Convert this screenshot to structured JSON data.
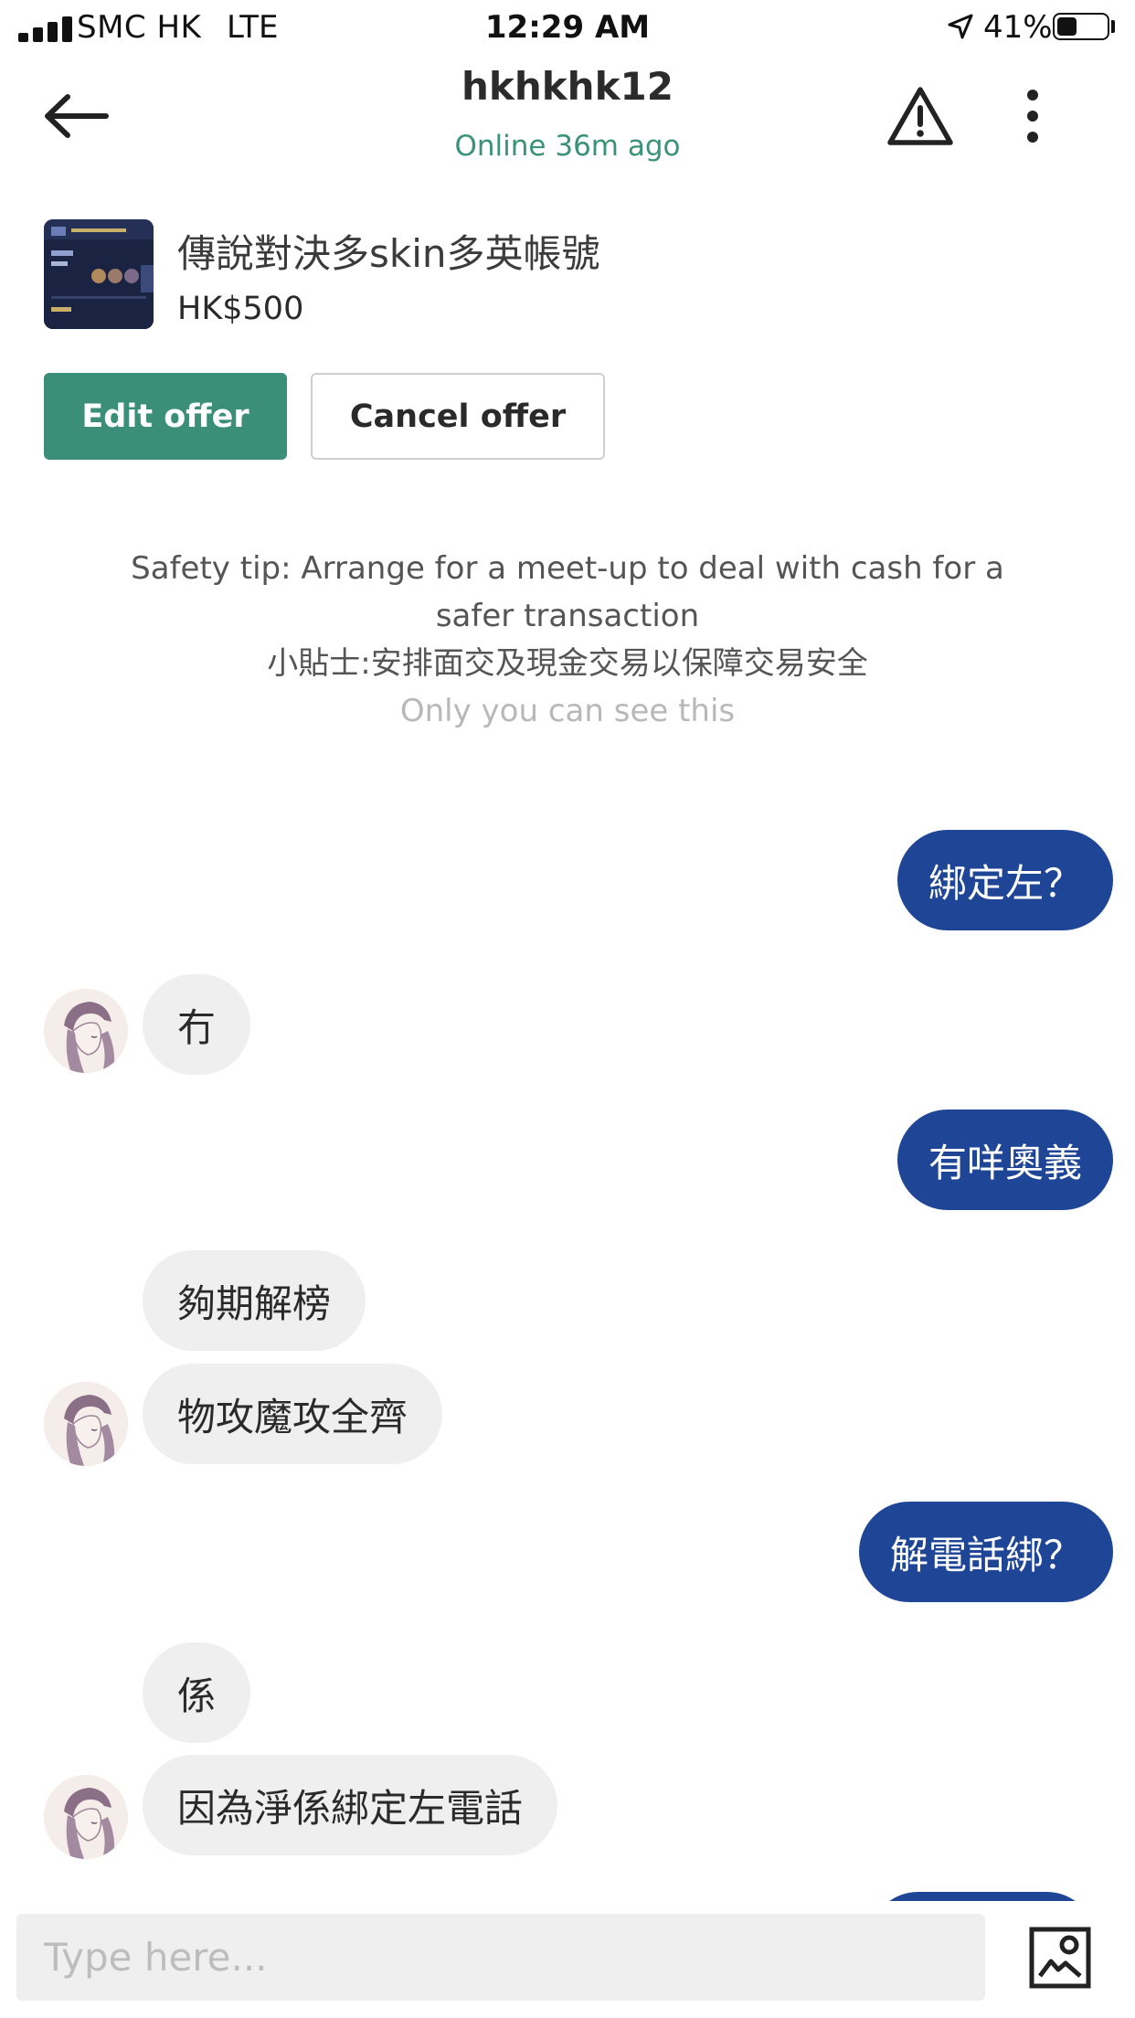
{
  "status_bar": {
    "carrier": "SMC HK",
    "network": "LTE",
    "time": "12:29 AM",
    "battery": "41%",
    "battery_level": 0.41
  },
  "header": {
    "title": "hkhkhk12",
    "subtitle": "Online 36m ago",
    "icons": {
      "back": "back-arrow-icon",
      "report": "warning-icon",
      "menu": "more-vertical-icon"
    }
  },
  "listing": {
    "title": "傳說對決多skin多英帳號",
    "price": "HK$500"
  },
  "actions": {
    "edit": "Edit offer",
    "cancel": "Cancel offer"
  },
  "safety_tip": {
    "en": "Safety tip: Arrange for a meet-up to deal with cash for a safer transaction",
    "zh": "小貼士:安排面交及現金交易以保障交易安全",
    "note": "Only you can see this"
  },
  "messages": [
    {
      "from": "me",
      "text": "綁定左？"
    },
    {
      "from": "them",
      "text": "冇"
    },
    {
      "from": "me",
      "text": "有咩奧義"
    },
    {
      "from": "them",
      "text": "夠期解榜"
    },
    {
      "from": "them",
      "text": "物攻魔攻全齊"
    },
    {
      "from": "me",
      "text": "解電話綁？"
    },
    {
      "from": "them",
      "text": "係"
    },
    {
      "from": "them",
      "text": "因為淨係綁定左電話"
    }
  ],
  "input": {
    "placeholder": "Type here...",
    "value": ""
  },
  "colors": {
    "accent_green": "#3b8f78",
    "bubble_out": "#1f4696",
    "bubble_in": "#efefef",
    "online_text": "#3a9278"
  }
}
